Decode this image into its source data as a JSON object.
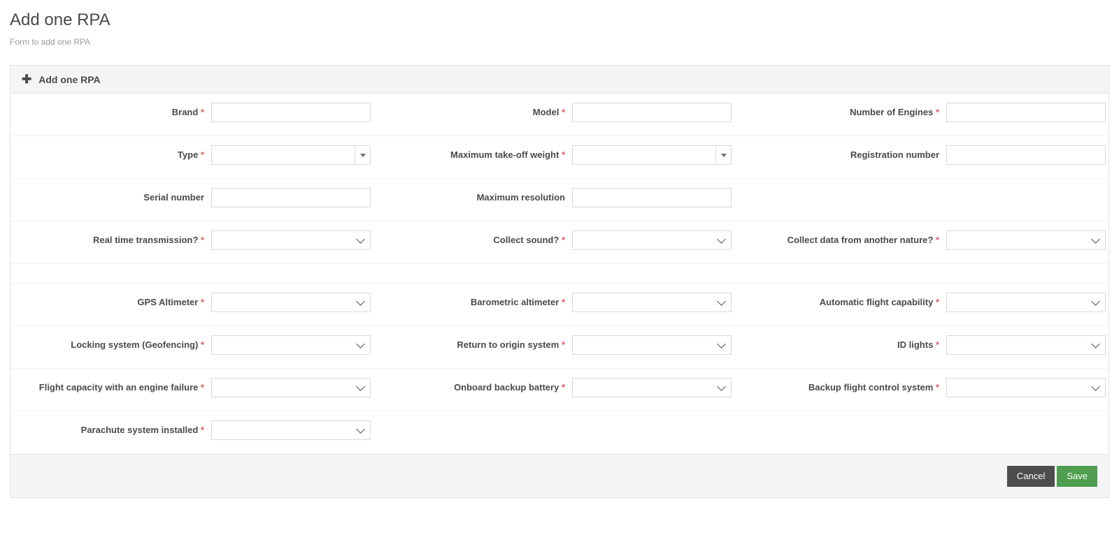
{
  "header": {
    "title": "Add one RPA",
    "subtitle": "Form to add one RPA"
  },
  "panel": {
    "plus_icon": "plus-icon",
    "title": "Add one RPA"
  },
  "form": {
    "required_marker": "*",
    "rows": [
      {
        "cells": [
          {
            "label": "Brand",
            "required": true,
            "control": "text"
          },
          {
            "label": "Model",
            "required": true,
            "control": "text"
          },
          {
            "label": "Number of Engines",
            "required": true,
            "control": "text"
          }
        ]
      },
      {
        "cells": [
          {
            "label": "Type",
            "required": true,
            "control": "dropdown"
          },
          {
            "label": "Maximum take-off weight",
            "required": true,
            "control": "dropdown"
          },
          {
            "label": "Registration number",
            "required": false,
            "control": "text"
          }
        ]
      },
      {
        "cells": [
          {
            "label": "Serial number",
            "required": false,
            "control": "text"
          },
          {
            "label": "Maximum resolution",
            "required": false,
            "control": "text"
          },
          {
            "label": "",
            "required": false,
            "control": "none"
          }
        ]
      },
      {
        "cells": [
          {
            "label": "Real time transmission?",
            "required": true,
            "control": "select"
          },
          {
            "label": "Collect sound?",
            "required": true,
            "control": "select"
          },
          {
            "label": "Collect data from another nature?",
            "required": true,
            "control": "select"
          }
        ]
      },
      {
        "spacer": true,
        "cells": []
      },
      {
        "cells": [
          {
            "label": "GPS Altimeter",
            "required": true,
            "control": "select"
          },
          {
            "label": "Barometric altimeter",
            "required": true,
            "control": "select"
          },
          {
            "label": "Automatic flight capability",
            "required": true,
            "control": "select"
          }
        ]
      },
      {
        "cells": [
          {
            "label": "Locking system (Geofencing)",
            "required": true,
            "control": "select"
          },
          {
            "label": "Return to origin system",
            "required": true,
            "control": "select"
          },
          {
            "label": "ID lights",
            "required": true,
            "control": "select"
          }
        ]
      },
      {
        "cells": [
          {
            "label": "Flight capacity with an engine failure",
            "required": true,
            "control": "select"
          },
          {
            "label": "Onboard backup battery",
            "required": true,
            "control": "select"
          },
          {
            "label": "Backup flight control system",
            "required": true,
            "control": "select"
          }
        ]
      },
      {
        "cells": [
          {
            "label": "Parachute system installed",
            "required": true,
            "control": "select"
          },
          {
            "label": "",
            "required": false,
            "control": "none"
          },
          {
            "label": "",
            "required": false,
            "control": "none"
          }
        ]
      }
    ]
  },
  "footer": {
    "cancel_label": "Cancel",
    "save_label": "Save"
  },
  "colors": {
    "required": "#e8595b",
    "save": "#4f9d4f",
    "cancel": "#4d4d4d",
    "panel_header_bg": "#f5f5f5",
    "border": "#e2e2e2"
  }
}
